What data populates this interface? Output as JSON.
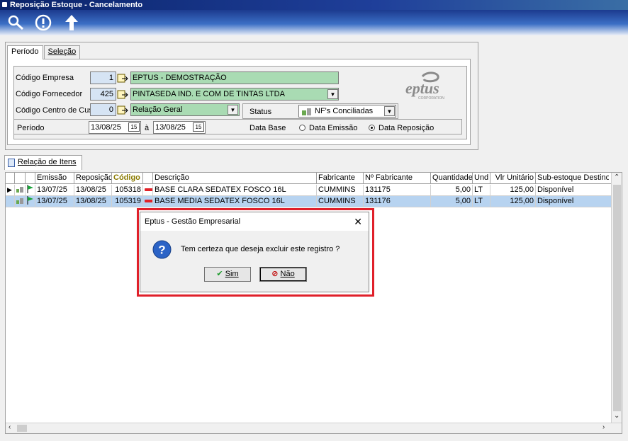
{
  "window": {
    "title": "Reposição Estoque - Cancelamento"
  },
  "toolbar": {
    "icons": [
      "search-icon",
      "alert-icon",
      "back-arrow-icon"
    ]
  },
  "top_tabs": {
    "tab1": "Período",
    "tab2": "Seleção"
  },
  "form": {
    "empresa": {
      "label": "Código Empresa",
      "code": "1",
      "name": "EPTUS - DEMOSTRAÇÃO"
    },
    "fornecedor": {
      "label": "Código Fornecedor",
      "code": "425",
      "name": "PINTASEDA IND. E COM DE TINTAS LTDA"
    },
    "centro_custo": {
      "label": "Código Centro de Custo",
      "code": "0",
      "name": "Relação Geral"
    },
    "status": {
      "label": "Status",
      "value": "NF's Conciliadas"
    },
    "periodo": {
      "label": "Período",
      "from": "13/08/25",
      "sep": "à",
      "to": "13/08/25"
    },
    "data_base": {
      "label": "Data Base",
      "option1": "Data Emissão",
      "option2": "Data Reposição",
      "selected": "Data Reposição"
    }
  },
  "logo": {
    "text": "eptus",
    "sub": "CORPORATION"
  },
  "items_tab": {
    "label": "Relação de Itens"
  },
  "grid": {
    "columns": [
      "Emissão",
      "Reposição",
      "Código",
      "Descrição",
      "Fabricante",
      "Nº Fabricante",
      "Quantidade",
      "Und",
      "Vlr Unitário",
      "Sub-estoque Destino"
    ],
    "rows": [
      {
        "emissao": "13/07/25",
        "reposicao": "13/08/25",
        "codigo": "105318",
        "descricao": "BASE CLARA SEDATEX FOSCO 16L",
        "fabricante": "CUMMINS",
        "nfab": "131175",
        "qtd": "5,00",
        "und": "LT",
        "vlr": "125,00",
        "sub": "Disponível"
      },
      {
        "emissao": "13/07/25",
        "reposicao": "13/08/25",
        "codigo": "105319",
        "descricao": "BASE MEDIA SEDATEX FOSCO 16L",
        "fabricante": "CUMMINS",
        "nfab": "131176",
        "qtd": "5,00",
        "und": "LT",
        "vlr": "125,00",
        "sub": "Disponível"
      }
    ]
  },
  "dialog": {
    "title": "Eptus - Gestão Empresarial",
    "message": "Tem certeza que deseja excluir este registro ?",
    "yes": "Sim",
    "no": "Não",
    "highlight_color": "#e0202a"
  }
}
